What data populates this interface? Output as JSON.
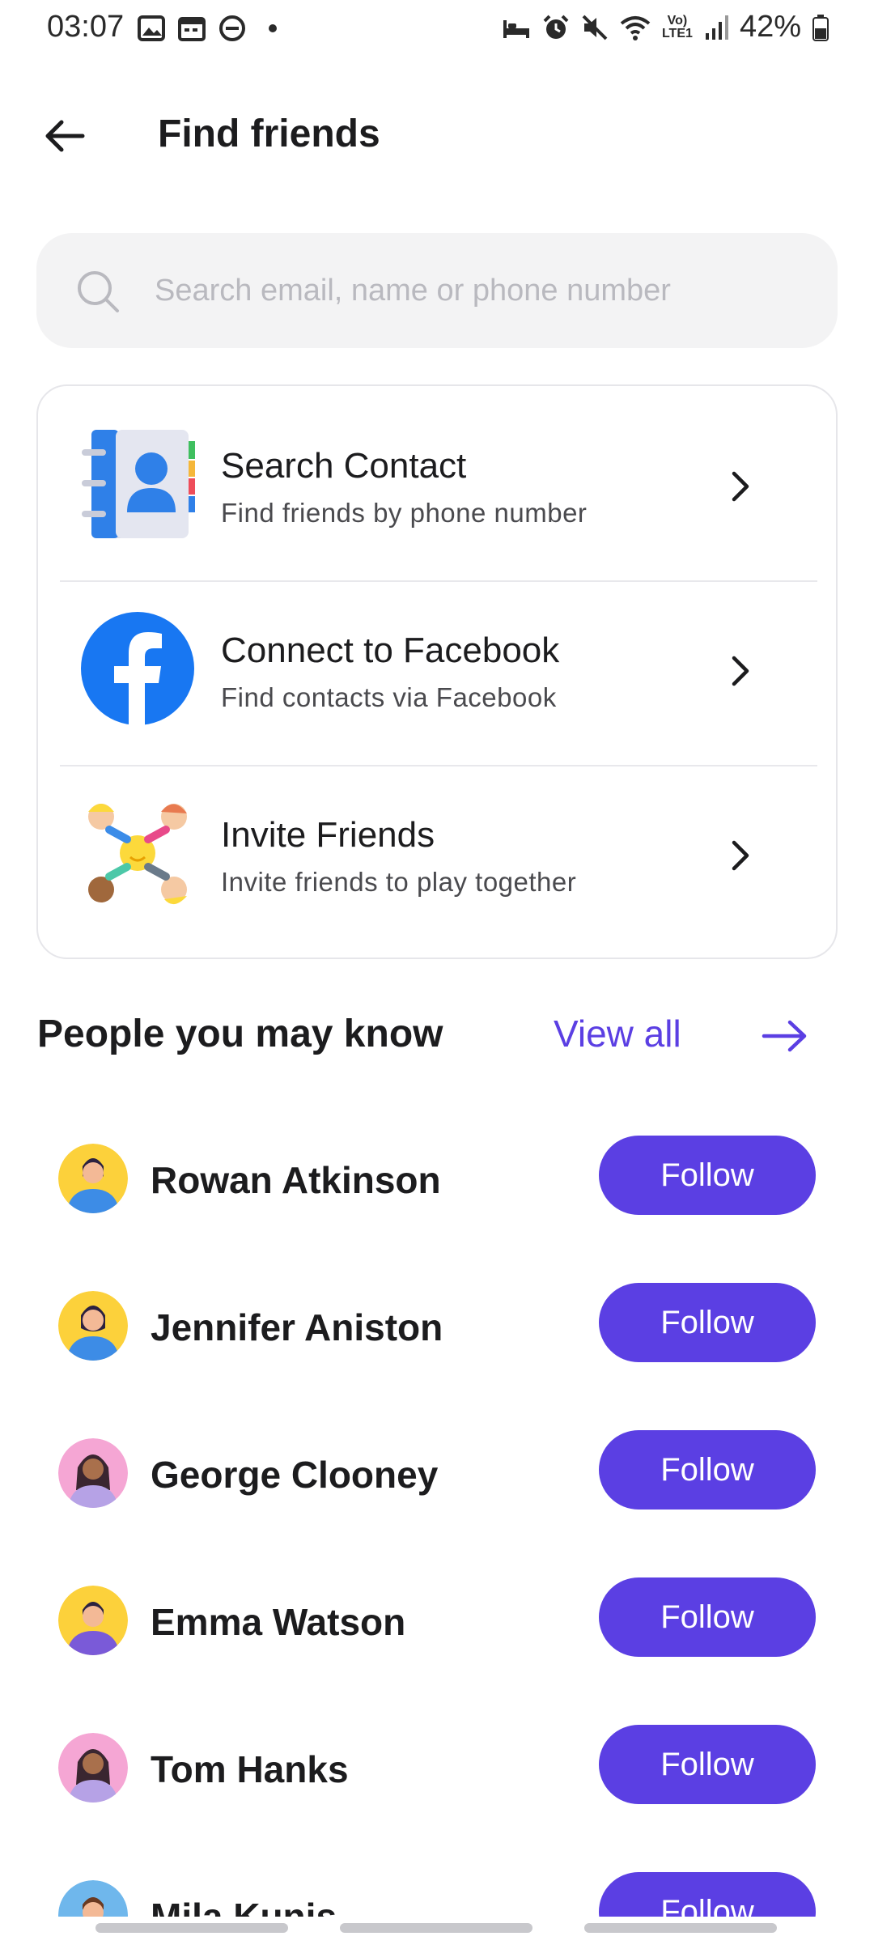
{
  "status_bar": {
    "time": "03:07",
    "battery_percent": "42%",
    "network_label": "Vo) LTE1",
    "left_icons": [
      "gallery-icon",
      "calendar-icon",
      "dnd-icon",
      "dot-icon"
    ],
    "right_icons": [
      "sleep-icon",
      "alarm-icon",
      "mute-icon",
      "wifi-icon",
      "signal-icon",
      "battery-icon"
    ]
  },
  "header": {
    "title": "Find friends",
    "back_icon": "arrow-left-icon"
  },
  "search": {
    "placeholder": "Search email, name or phone number",
    "value": ""
  },
  "options": [
    {
      "title": "Search Contact",
      "subtitle": "Find friends by phone number",
      "icon": "contacts-book-icon"
    },
    {
      "title": "Connect to Facebook",
      "subtitle": "Find contacts via Facebook",
      "icon": "facebook-icon"
    },
    {
      "title": "Invite Friends",
      "subtitle": "Invite friends to play together",
      "icon": "friends-circle-icon"
    }
  ],
  "people_section": {
    "title": "People you may know",
    "view_all": "View all"
  },
  "people": [
    {
      "name": "Rowan Atkinson",
      "button": "Follow"
    },
    {
      "name": "Jennifer Aniston",
      "button": "Follow"
    },
    {
      "name": "George Clooney",
      "button": "Follow"
    },
    {
      "name": "Emma Watson",
      "button": "Follow"
    },
    {
      "name": "Tom Hanks",
      "button": "Follow"
    },
    {
      "name": "Mila Kunis",
      "button": "Follow"
    }
  ],
  "colors": {
    "accent": "#5b3fe3",
    "facebook": "#1877f2",
    "search_bg": "#f3f3f4"
  }
}
